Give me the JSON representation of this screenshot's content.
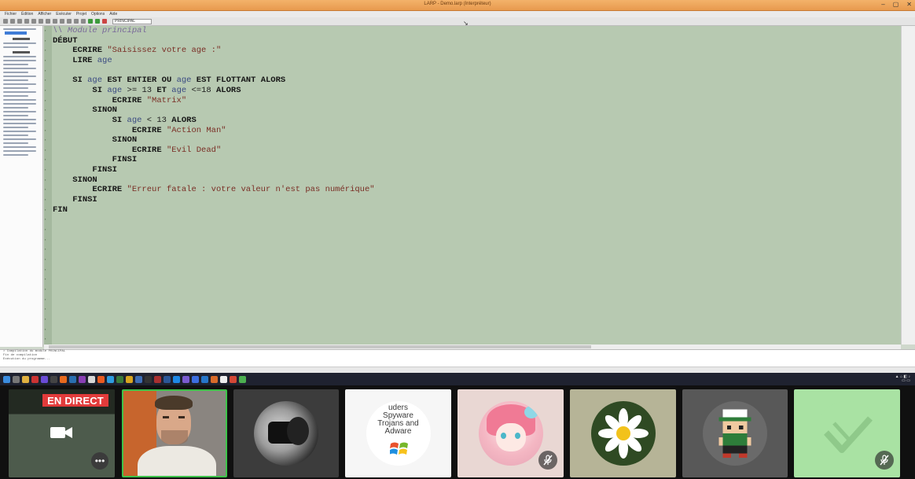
{
  "app": {
    "title": "LARP - Demo.larp (Interpréteur)",
    "menus": [
      "Fichier",
      "Édition",
      "Afficher",
      "Exécuter",
      "Projet",
      "Options",
      "Aide"
    ],
    "toolbar_select": "PRINCIPAL"
  },
  "editor": {
    "lines": [
      [
        [
          "cmt",
          "\\\\ Module principal"
        ]
      ],
      [
        [
          "kw",
          "DÉBUT"
        ]
      ],
      [
        [
          "op",
          "    "
        ],
        [
          "kw",
          "ECRIRE "
        ],
        [
          "str",
          "\"Saisissez votre age :\""
        ]
      ],
      [
        [
          "op",
          "    "
        ],
        [
          "kw",
          "LIRE "
        ],
        [
          "var",
          "age"
        ]
      ],
      [
        [
          "op",
          ""
        ]
      ],
      [
        [
          "op",
          "    "
        ],
        [
          "kw",
          "SI "
        ],
        [
          "var",
          "age "
        ],
        [
          "kw",
          "EST ENTIER OU "
        ],
        [
          "var",
          "age "
        ],
        [
          "kw",
          "EST FLOTTANT ALORS"
        ]
      ],
      [
        [
          "op",
          "        "
        ],
        [
          "kw",
          "SI "
        ],
        [
          "var",
          "age "
        ],
        [
          "op",
          ">= 13 "
        ],
        [
          "kw",
          "ET "
        ],
        [
          "var",
          "age "
        ],
        [
          "op",
          "<=18 "
        ],
        [
          "kw",
          "ALORS"
        ]
      ],
      [
        [
          "op",
          "            "
        ],
        [
          "kw",
          "ECRIRE "
        ],
        [
          "str",
          "\"Matrix\""
        ]
      ],
      [
        [
          "op",
          "        "
        ],
        [
          "kw",
          "SINON"
        ]
      ],
      [
        [
          "op",
          "            "
        ],
        [
          "kw",
          "SI "
        ],
        [
          "var",
          "age "
        ],
        [
          "op",
          "< 13 "
        ],
        [
          "kw",
          "ALORS"
        ]
      ],
      [
        [
          "op",
          "                "
        ],
        [
          "kw",
          "ECRIRE "
        ],
        [
          "str",
          "\"Action Man\""
        ]
      ],
      [
        [
          "op",
          "            "
        ],
        [
          "kw",
          "SINON"
        ]
      ],
      [
        [
          "op",
          "                "
        ],
        [
          "kw",
          "ECRIRE "
        ],
        [
          "str",
          "\"Evil Dead\""
        ]
      ],
      [
        [
          "op",
          "            "
        ],
        [
          "kw",
          "FINSI"
        ]
      ],
      [
        [
          "op",
          "        "
        ],
        [
          "kw",
          "FINSI"
        ]
      ],
      [
        [
          "op",
          "    "
        ],
        [
          "kw",
          "SINON"
        ]
      ],
      [
        [
          "op",
          "        "
        ],
        [
          "kw",
          "ECRIRE "
        ],
        [
          "str",
          "\"Erreur fatale : votre valeur n'est pas numérique\""
        ]
      ],
      [
        [
          "op",
          "    "
        ],
        [
          "kw",
          "FINSI"
        ]
      ],
      [
        [
          "kw",
          "FIN"
        ]
      ]
    ]
  },
  "console": {
    "lines": [
      "> Compilation du module PRINCIPAL",
      "Fin de compilation",
      "Exécution du programme..."
    ]
  },
  "participants": {
    "live_badge": "EN DIRECT",
    "more_label": "•••",
    "tiles": [
      {
        "name": "screen-share-tile",
        "bg": "#2f3b2e"
      },
      {
        "name": "camera-tile",
        "bg": "#6b5f55",
        "active": true
      },
      {
        "name": "photographer-avatar-tile",
        "bg": "#3c3c3c"
      },
      {
        "name": "spyware-avatar-tile",
        "bg": "#f6f6f6",
        "avatar_text": [
          "uders",
          "Spyware",
          "Trojans and",
          "Adware"
        ]
      },
      {
        "name": "anime-avatar-tile",
        "bg": "#e9d7d3",
        "muted": true
      },
      {
        "name": "daisy-avatar-tile",
        "bg": "#b6b497"
      },
      {
        "name": "pixel-avatar-tile",
        "bg": "#585858"
      },
      {
        "name": "logo-avatar-tile",
        "bg": "#a9e2a3",
        "muted": true
      }
    ]
  }
}
